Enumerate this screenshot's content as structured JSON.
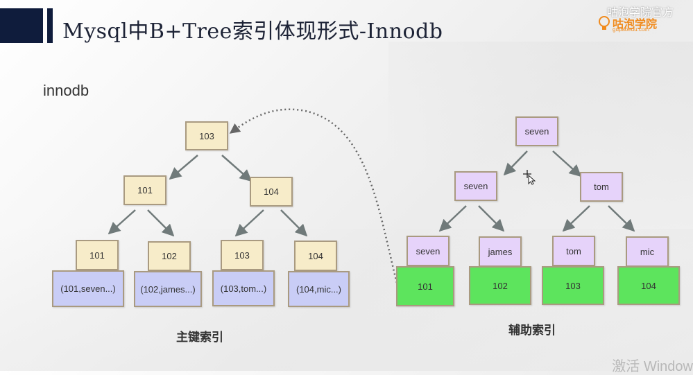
{
  "header": {
    "title": "Mysql中B+Tree索引体现形式-Innodb",
    "watermark": "咕泡学院官方",
    "logo_name": "咕泡学院",
    "logo_url": "gupaoedu.com"
  },
  "subtitle": "innodb",
  "primary_index": {
    "caption": "主键索引",
    "root": "103",
    "level2": [
      "101",
      "104"
    ],
    "leaf_keys": [
      "101",
      "102",
      "103",
      "104"
    ],
    "leaf_rows": [
      "(101,seven...)",
      "(102,james...)",
      "(103,tom...)",
      "(104,mic...)"
    ]
  },
  "secondary_index": {
    "caption": "辅助索引",
    "root": "seven",
    "level2": [
      "seven",
      "tom"
    ],
    "leaf_keys": [
      "seven",
      "james",
      "tom",
      "mic"
    ],
    "leaf_ids": [
      "101",
      "102",
      "103",
      "104"
    ]
  },
  "activation": "激活 Windows",
  "colors": {
    "header_navy": "#0f1c3c",
    "primary_key_node": "#f7ecc9",
    "primary_row_node": "#c9cdf6",
    "secondary_key_node": "#e6d3fa",
    "secondary_id_node": "#5de45d",
    "arrow": "#707a7a"
  }
}
